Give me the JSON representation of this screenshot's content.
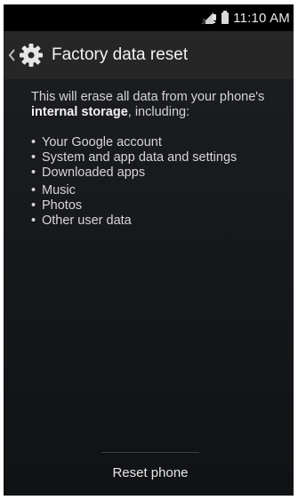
{
  "status_bar": {
    "time": "11:10 AM",
    "icons": [
      "no-sim-signal-icon",
      "battery-icon"
    ]
  },
  "action_bar": {
    "title": "Factory data reset",
    "icons": [
      "back-chevron-icon",
      "settings-gear-icon"
    ]
  },
  "content": {
    "intro_prefix": "This will erase all data from your phone's ",
    "intro_bold": "internal storage",
    "intro_suffix": ", including:",
    "items": [
      "Your Google account",
      "System and app data and settings",
      "Downloaded apps",
      "Music",
      "Photos",
      "Other user data"
    ]
  },
  "footer": {
    "button_label": "Reset phone"
  },
  "colors": {
    "background": "#15171a",
    "action_bar": "#262626",
    "text": "#d6d6d6"
  }
}
